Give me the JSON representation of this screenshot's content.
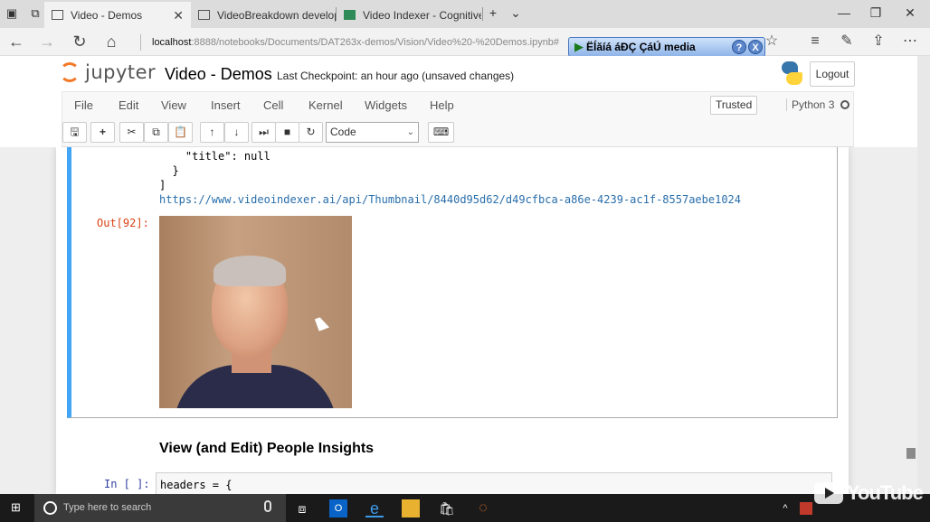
{
  "browser": {
    "tabs": [
      {
        "label": "Video - Demos",
        "active": true
      },
      {
        "label": "VideoBreakdown developer",
        "active": false
      },
      {
        "label": "Video Indexer - Cognitive V",
        "active": false
      }
    ],
    "new_tab_symbol": "+",
    "tab_list_symbol": "⌄",
    "window_controls": {
      "minimize": "—",
      "restore": "❐",
      "close": "✕"
    },
    "nav": {
      "back": "←",
      "forward": "→",
      "refresh": "↻",
      "home": "⌂"
    },
    "url_host": "localhost",
    "url_path": ":8888/notebooks/Documents/DAT263x-demos/Vision/Video%20-%20Demos.ipynb#",
    "toolbar_icons": {
      "favorites": "☆",
      "hub": "≡",
      "notes": "✎",
      "share": "⇪",
      "more": "⋯"
    },
    "media_overlay": {
      "text": "Ëĺăíá áĐÇ ÇáÚ media",
      "help": "?",
      "close": "X",
      "play": "▶"
    }
  },
  "jupyter": {
    "logo_text": "jupyter",
    "notebook_title": "Video - Demos",
    "checkpoint": "Last Checkpoint: an hour ago (unsaved changes)",
    "logout_label": "Logout",
    "menu": [
      "File",
      "Edit",
      "View",
      "Insert",
      "Cell",
      "Kernel",
      "Widgets",
      "Help"
    ],
    "trusted_label": "Trusted",
    "kernel_label": "Python 3",
    "toolbar": {
      "save": "🖫",
      "add": "+",
      "cut": "✂",
      "copy": "⧉",
      "paste": "📋",
      "up": "↑",
      "down": "↓",
      "run": "⏭",
      "stop": "■",
      "restart": "↻",
      "keyboard": "⌨"
    },
    "cell_type": "Code"
  },
  "notebook": {
    "output_lines": [
      "    \"title\": null",
      "  }",
      "]"
    ],
    "thumbnail_url": "https://www.videoindexer.ai/api/Thumbnail/8440d95d62/d49cfbca-a86e-4239-ac1f-8557aebe1024",
    "out_prompt": "Out[92]:",
    "section_heading": "View (and Edit) People Insights",
    "in_prompt": "In [ ]:",
    "input_code": "headers = {"
  },
  "taskbar": {
    "start": "⊞",
    "search_placeholder": "Type here to search",
    "icons": [
      "task-view",
      "outlook",
      "edge",
      "file-explorer",
      "store",
      "jupyter"
    ],
    "tray": {
      "chevron": "^"
    }
  },
  "watermark": {
    "text": "YouTube"
  }
}
